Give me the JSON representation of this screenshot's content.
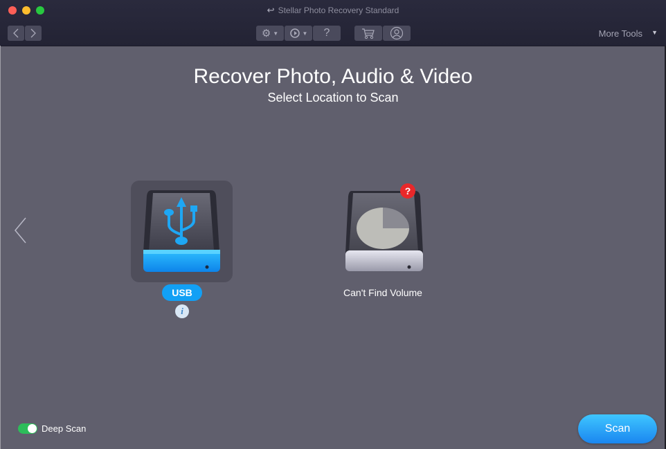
{
  "window": {
    "title": "Stellar Photo Recovery Standard",
    "title_icon": "back-arrow-icon"
  },
  "toolbar": {
    "back_icon": "chevron-left-icon",
    "forward_icon": "chevron-right-icon",
    "settings_icon": "gear-icon",
    "history_icon": "history-icon",
    "help_label": "?",
    "cart_icon": "cart-icon",
    "account_icon": "user-icon",
    "more_tools_label": "More Tools",
    "caret": "▼"
  },
  "main": {
    "title": "Recover Photo, Audio & Video",
    "subtitle": "Select Location to Scan",
    "drives": [
      {
        "label": "USB",
        "icon": "usb-drive-icon",
        "selected": true,
        "info_label": "i"
      },
      {
        "label": "Can't Find Volume",
        "icon": "volume-drive-icon",
        "selected": false,
        "badge": "?"
      }
    ]
  },
  "footer": {
    "deep_scan_label": "Deep Scan",
    "deep_scan_on": true,
    "scan_label": "Scan"
  },
  "colors": {
    "accent": "#12a0f5",
    "toggle_on": "#2dbd5a",
    "badge": "#e8282a",
    "background": "#605f6d"
  }
}
